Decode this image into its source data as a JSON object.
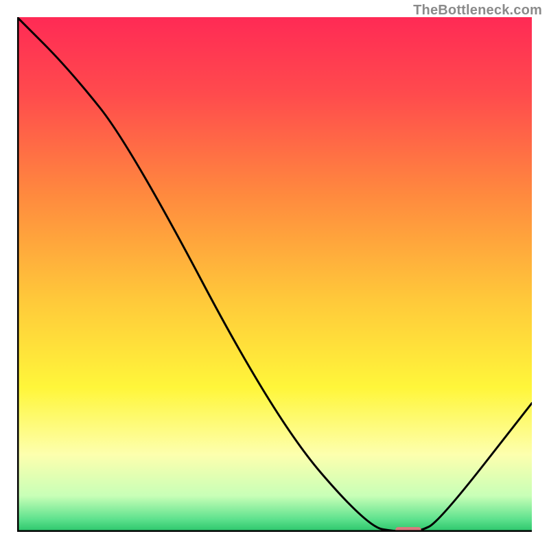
{
  "watermark": "TheBottleneck.com",
  "chart_data": {
    "type": "line",
    "title": "",
    "xlabel": "",
    "ylabel": "",
    "xlim": [
      0,
      100
    ],
    "ylim": [
      0,
      100
    ],
    "x": [
      0,
      10,
      22,
      50,
      68,
      74,
      78,
      82,
      100
    ],
    "values": [
      100,
      90,
      75,
      22,
      1,
      0,
      0,
      2,
      25
    ],
    "marker": {
      "x": 76,
      "y": 0,
      "color": "#d97a7e",
      "width": 5,
      "height": 1.2
    },
    "gradient_stops": [
      {
        "offset": 0.0,
        "color": "#ff2a55"
      },
      {
        "offset": 0.15,
        "color": "#ff4b4d"
      },
      {
        "offset": 0.35,
        "color": "#ff8b3e"
      },
      {
        "offset": 0.55,
        "color": "#ffc93a"
      },
      {
        "offset": 0.72,
        "color": "#fff63a"
      },
      {
        "offset": 0.85,
        "color": "#fdffae"
      },
      {
        "offset": 0.93,
        "color": "#c8ffb7"
      },
      {
        "offset": 0.975,
        "color": "#5fe28e"
      },
      {
        "offset": 1.0,
        "color": "#29c46a"
      }
    ],
    "axis_color": "#000000",
    "line_color": "#000000",
    "line_width": 3
  }
}
